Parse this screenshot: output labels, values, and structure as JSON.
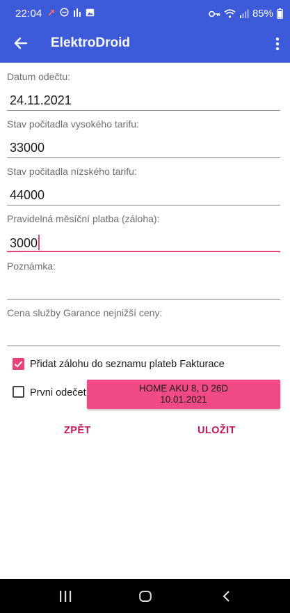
{
  "status": {
    "time": "22:04",
    "battery": "85%",
    "icons": [
      "missed-call-icon",
      "dnd-icon",
      "bars-icon",
      "image-icon",
      "key-icon",
      "wifi-icon",
      "signal-icon",
      "battery-icon"
    ]
  },
  "appbar": {
    "title": "ElektroDroid"
  },
  "form": {
    "date_label": "Datum odečtu:",
    "date_value": "24.11.2021",
    "high_label": "Stav počitadla vysokého tarifu:",
    "high_value": "33000",
    "low_label": "Stav počitadla nízského tarifu:",
    "low_value": "44000",
    "payment_label": "Pravidelná měsíční platba (záloha):",
    "payment_value": "3000",
    "note_label": "Poznámka:",
    "note_value": "",
    "guarantee_label": "Cena služby Garance nejnižší ceny:",
    "guarantee_value": ""
  },
  "checks": {
    "add_payment_label": "Přidat zálohu do seznamu plateb Fakturace",
    "add_payment_checked": true,
    "first_reading_label": "Prvni odečet",
    "first_reading_checked": false
  },
  "tariff_button": {
    "line1": "HOME AKU 8, D 26D",
    "line2": "10.01.2021"
  },
  "actions": {
    "back_label": "ZPĚT",
    "save_label": "ULOŽIT"
  },
  "colors": {
    "primary": "#3d5bd9",
    "accent": "#e9437c",
    "button_pink": "#f24a86",
    "text_button": "#c2185b"
  }
}
